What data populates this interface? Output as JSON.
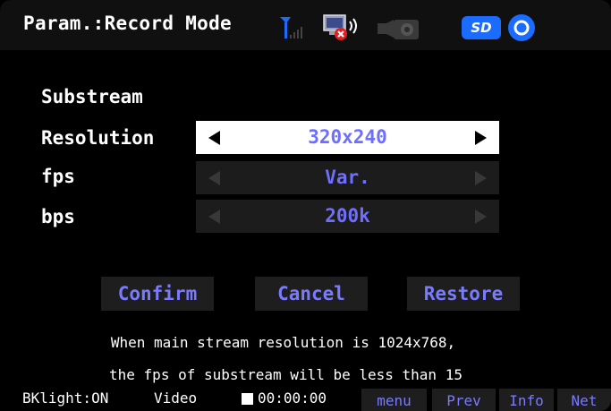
{
  "header": {
    "title": "Param.:Record Mode",
    "icons": [
      "signal-antenna-icon",
      "network-disconnected-icon",
      "camera-icon",
      "sd-card-icon",
      "disc-icon"
    ],
    "sd_label": "SD"
  },
  "form": {
    "section_title": "Substream",
    "fields": [
      {
        "label": "Resolution",
        "value": "320x240",
        "active": true
      },
      {
        "label": "fps",
        "value": "Var.",
        "active": false
      },
      {
        "label": "bps",
        "value": "200k",
        "active": false
      }
    ]
  },
  "buttons": {
    "confirm": "Confirm",
    "cancel": "Cancel",
    "restore": "Restore"
  },
  "note": {
    "line1": "When main stream resolution is 1024x768,",
    "line2": "the fps of substream will be less than 15"
  },
  "bottom": {
    "backlight": "BKlight:ON",
    "mode": "Video",
    "time": "00:00:00",
    "menu": "menu",
    "prev": "Prev",
    "info": "Info",
    "net": "Net"
  },
  "colors": {
    "accent": "#6f6fff",
    "sd_badge": "#1b6bff",
    "error": "#e02020"
  }
}
